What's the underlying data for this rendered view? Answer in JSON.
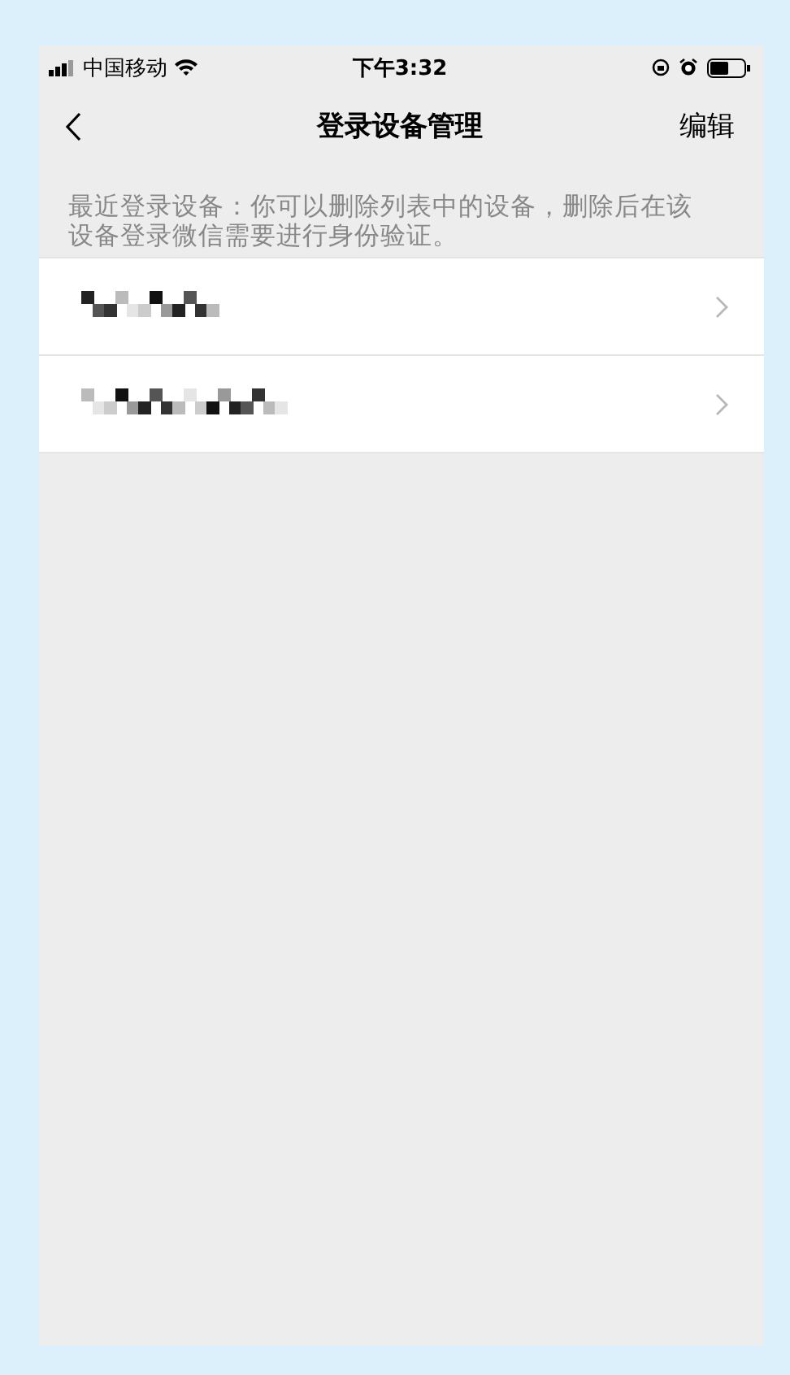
{
  "status_bar": {
    "carrier": "中国移动",
    "time": "下午3:32"
  },
  "nav": {
    "title": "登录设备管理",
    "action": "编辑"
  },
  "hint": "最近登录设备：你可以删除列表中的设备，删除后在该设备登录微信需要进行身份验证。"
}
